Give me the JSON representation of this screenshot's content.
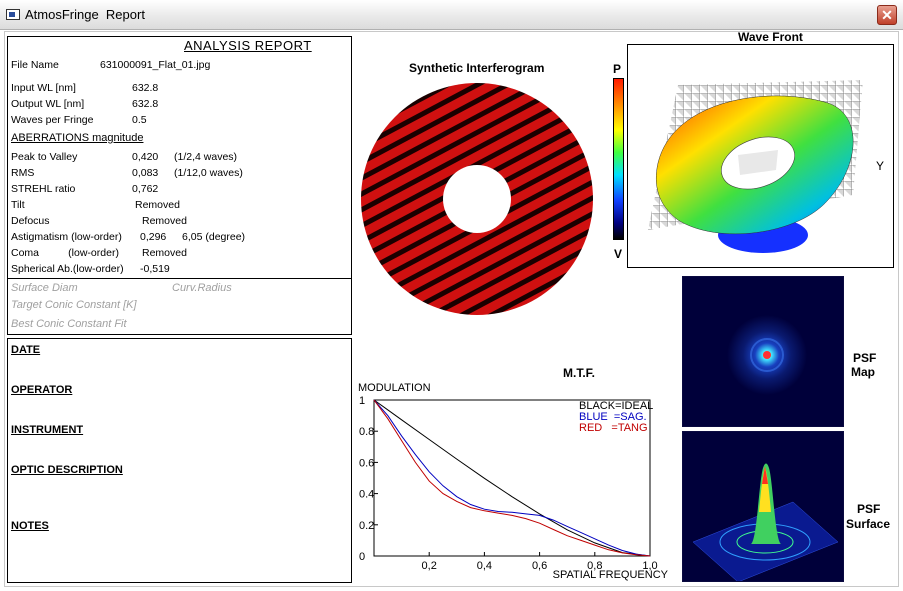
{
  "window": {
    "title": "AtmosFringe  Report",
    "close_label": "✕",
    "icon": "app-window-icon"
  },
  "report": {
    "title": "ANALYSIS  REPORT",
    "file_label": "File Name",
    "file_value": "631000091_Flat_01.jpg",
    "input_wl_label": "Input  WL [nm]",
    "input_wl_value": "632.8",
    "output_wl_label": "Output WL [nm]",
    "output_wl_value": "632.8",
    "wpf_label": "Waves per Fringe",
    "wpf_value": "0.5",
    "aberr_title": "ABERRATIONS magnitude",
    "rows": [
      {
        "label": "Peak to Valley",
        "value": "0,420",
        "extra": "(1/2,4 waves)"
      },
      {
        "label": "RMS",
        "value": "0,083",
        "extra": "(1/12,0 waves)"
      },
      {
        "label": "STREHL ratio",
        "value": "0,762",
        "extra": ""
      },
      {
        "label": "Tilt",
        "value": "Removed",
        "extra": ""
      },
      {
        "label": "Defocus",
        "value": "Removed",
        "extra": ""
      },
      {
        "label": "Astigmatism  (low-order)",
        "value": "0,296",
        "extra": "6,05  (degree)"
      },
      {
        "label": "Coma          (low-order)",
        "value": "Removed",
        "extra": ""
      },
      {
        "label": "Spherical Ab.(low-order)",
        "value": "-0,519",
        "extra": ""
      }
    ],
    "surface_diam": "Surface Diam",
    "curv_radius": "Curv.Radius",
    "target_conic": "Target Conic Constant [K]",
    "best_conic": "Best Conic Constant Fit"
  },
  "info": {
    "date": "DATE",
    "operator": "OPERATOR",
    "instrument": "INSTRUMENT",
    "optic": "OPTIC DESCRIPTION",
    "notes": "NOTES"
  },
  "interferogram": {
    "title": "Synthetic Interferogram",
    "top": "P",
    "bottom": "V"
  },
  "wavefront": {
    "title": "Wave Front",
    "y_label": "Y"
  },
  "psf": {
    "map_label_1": "PSF",
    "map_label_2": "Map",
    "surface_label_1": "PSF",
    "surface_label_2": "Surface"
  },
  "chart_data": {
    "type": "line",
    "title": "M.T.F.",
    "ylabel": "MODULATION",
    "xlabel": "SPATIAL FREQUENCY",
    "xlim": [
      0,
      1.0
    ],
    "ylim": [
      0,
      1
    ],
    "xticks": [
      "0,2",
      "0,4",
      "0,6",
      "0,8",
      "1,0"
    ],
    "yticks": [
      "0",
      "0.2",
      "0.4",
      "0.6",
      "0.8",
      "1"
    ],
    "legend": [
      {
        "text": "BLACK=IDEAL",
        "color": "#000000"
      },
      {
        "text": "BLUE  =SAG.",
        "color": "#0000c0"
      },
      {
        "text": "RED   =TANG",
        "color": "#c00000"
      }
    ],
    "series": [
      {
        "name": "BLACK=IDEAL",
        "color": "#000000",
        "x": [
          0,
          0.1,
          0.2,
          0.3,
          0.4,
          0.5,
          0.6,
          0.7,
          0.8,
          0.9,
          1.0
        ],
        "y": [
          1.0,
          0.873,
          0.747,
          0.621,
          0.498,
          0.38,
          0.27,
          0.168,
          0.084,
          0.022,
          0.0
        ]
      },
      {
        "name": "BLUE  =SAG.",
        "color": "#0000c0",
        "x": [
          0,
          0.05,
          0.1,
          0.15,
          0.2,
          0.25,
          0.3,
          0.35,
          0.4,
          0.45,
          0.5,
          0.55,
          0.6,
          0.65,
          0.7,
          0.75,
          0.8,
          0.85,
          0.9,
          0.95,
          1.0
        ],
        "y": [
          1.0,
          0.9,
          0.77,
          0.65,
          0.54,
          0.45,
          0.38,
          0.33,
          0.3,
          0.285,
          0.28,
          0.27,
          0.26,
          0.23,
          0.19,
          0.15,
          0.11,
          0.07,
          0.035,
          0.012,
          0.0
        ]
      },
      {
        "name": "RED   =TANG",
        "color": "#c00000",
        "x": [
          0,
          0.05,
          0.1,
          0.15,
          0.2,
          0.25,
          0.3,
          0.35,
          0.4,
          0.45,
          0.5,
          0.55,
          0.6,
          0.65,
          0.7,
          0.75,
          0.8,
          0.85,
          0.9,
          0.95,
          1.0
        ],
        "y": [
          1.0,
          0.88,
          0.74,
          0.6,
          0.48,
          0.4,
          0.35,
          0.31,
          0.29,
          0.275,
          0.26,
          0.24,
          0.21,
          0.17,
          0.13,
          0.1,
          0.07,
          0.04,
          0.02,
          0.008,
          0.0
        ]
      }
    ]
  }
}
